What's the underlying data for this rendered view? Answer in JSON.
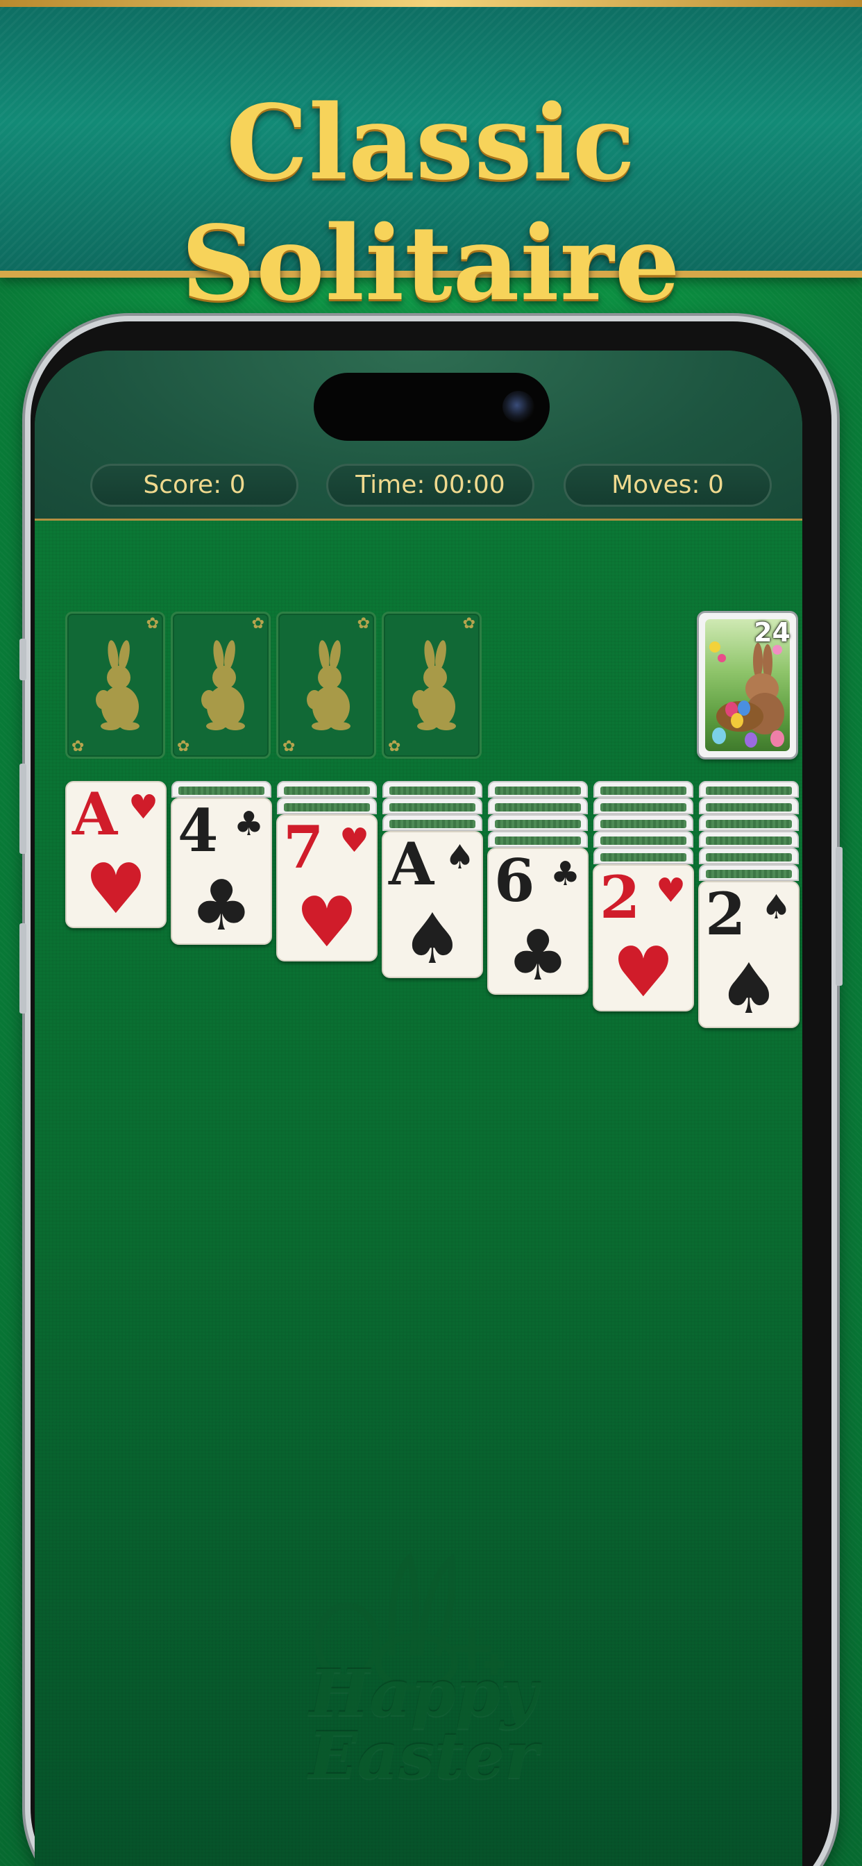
{
  "banner": {
    "title": "Classic Solitaire"
  },
  "hud": {
    "score_label": "Score:",
    "score_value": "0",
    "time_label": "Time:",
    "time_value": "00:00",
    "moves_label": "Moves:",
    "moves_value": "0"
  },
  "stock": {
    "count": "24"
  },
  "foundations": [
    "empty",
    "empty",
    "empty",
    "empty"
  ],
  "tableau": [
    {
      "hidden": 0,
      "rank": "A",
      "suit": "♥",
      "color": "red"
    },
    {
      "hidden": 1,
      "rank": "4",
      "suit": "♣",
      "color": "black"
    },
    {
      "hidden": 2,
      "rank": "7",
      "suit": "♥",
      "color": "red"
    },
    {
      "hidden": 3,
      "rank": "A",
      "suit": "♠",
      "color": "black"
    },
    {
      "hidden": 4,
      "rank": "6",
      "suit": "♣",
      "color": "black"
    },
    {
      "hidden": 5,
      "rank": "2",
      "suit": "♥",
      "color": "red"
    },
    {
      "hidden": 6,
      "rank": "2",
      "suit": "♠",
      "color": "black"
    }
  ],
  "watermark": {
    "line1": "Happy",
    "line2": "Easter"
  },
  "colors": {
    "felt": "#0a7d3a",
    "banner": "#128a76",
    "gold": "#f7d35a",
    "red_suit": "#d01c2a"
  }
}
